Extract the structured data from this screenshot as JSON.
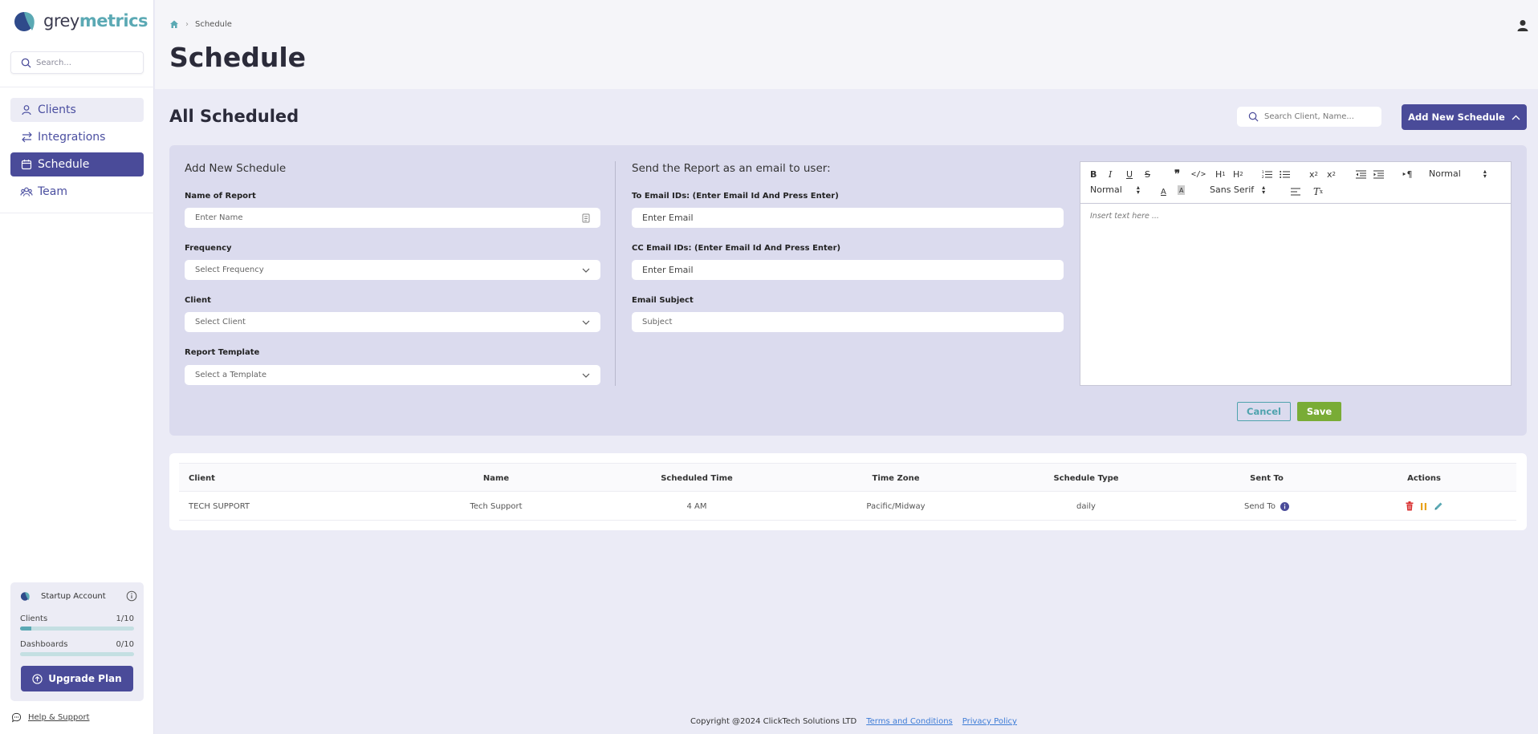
{
  "brand": {
    "prefix": "grey",
    "suffix": "metrics"
  },
  "sidebar": {
    "search_placeholder": "Search...",
    "items": [
      {
        "label": "Clients",
        "icon": "user-icon"
      },
      {
        "label": "Integrations",
        "icon": "arrows-exchange-icon"
      },
      {
        "label": "Schedule",
        "icon": "calendar-icon",
        "active": true
      },
      {
        "label": "Team",
        "icon": "team-icon"
      }
    ],
    "account": {
      "title": "Startup Account",
      "meters": [
        {
          "label": "Clients",
          "count": "1/10",
          "fraction": 0.1
        },
        {
          "label": "Dashboards",
          "count": "0/10",
          "fraction": 0.0
        }
      ],
      "upgrade_label": "Upgrade Plan"
    },
    "help_label": "Help & Support"
  },
  "header": {
    "breadcrumb": "Schedule",
    "title": "Schedule"
  },
  "section": {
    "title": "All Scheduled",
    "search_placeholder": "Search Client, Name...",
    "add_button": "Add New Schedule"
  },
  "form": {
    "left_title": "Add New Schedule",
    "name_label": "Name of Report",
    "name_placeholder": "Enter Name",
    "frequency_label": "Frequency",
    "frequency_value": "Select Frequency",
    "client_label": "Client",
    "client_value": "Select Client",
    "template_label": "Report Template",
    "template_value": "Select a Template",
    "mid_title": "Send the Report as an email to user:",
    "to_label": "To Email IDs: (Enter Email Id And Press Enter)",
    "to_placeholder": "Enter Email",
    "cc_label": "CC Email IDs: (Enter Email Id And Press Enter)",
    "cc_placeholder": "Enter Email",
    "subject_label": "Email Subject",
    "subject_placeholder": "Subject",
    "editor": {
      "header_select": "Normal",
      "size_select": "Normal",
      "font_select": "Sans Serif",
      "placeholder": "Insert text here ..."
    },
    "cancel_label": "Cancel",
    "save_label": "Save"
  },
  "table": {
    "columns": [
      "Client",
      "Name",
      "Scheduled Time",
      "Time Zone",
      "Schedule Type",
      "Sent To",
      "Actions"
    ],
    "rows": [
      {
        "client": "TECH SUPPORT",
        "name": "Tech Support",
        "time": "4 AM",
        "timezone": "Pacific/Midway",
        "type": "daily",
        "sent_to": "Send To"
      }
    ]
  },
  "footer": {
    "copyright": "Copyright @2024 ClickTech Solutions LTD",
    "terms": "Terms and Conditions",
    "privacy": "Privacy Policy"
  },
  "colors": {
    "primary": "#4a4b99",
    "accent": "#5ba9b4",
    "save": "#79ac36",
    "delete": "#d93030",
    "pause": "#e8a21a"
  }
}
